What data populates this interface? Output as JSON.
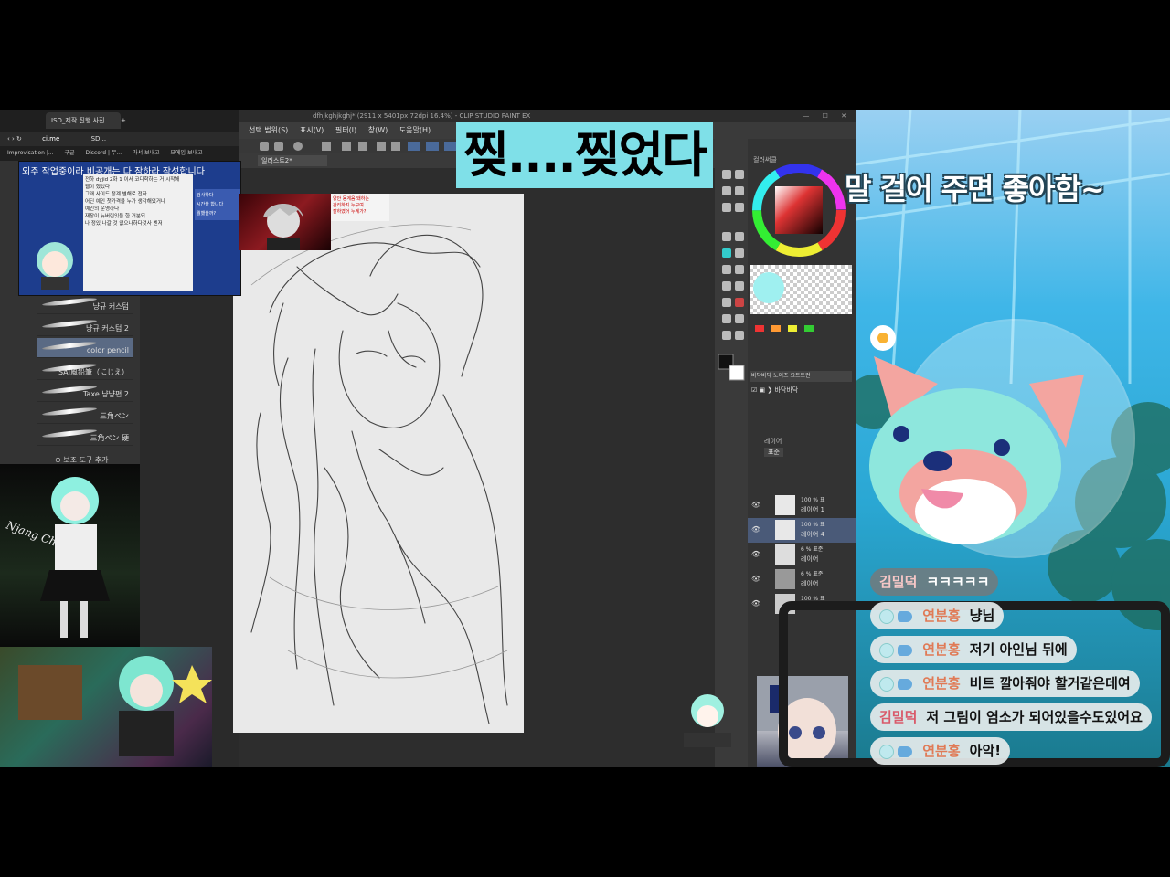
{
  "browser": {
    "tab_title": "ISD_제작 진행 사진",
    "new_tab": "+",
    "url": "ci.me",
    "url_tab2": "ISD...",
    "bookmarks": [
      "Improvisation |...",
      "구글",
      "Discord | 무...",
      "가서 보내고",
      "모에임 보내고"
    ]
  },
  "preview": {
    "title": "외주 작업중이라 비공개는 다 잠하라 작성합니다",
    "doc_lines": [
      "전하 dyjid 2화 1 이서 코디학하는 거 시작해",
      "웹이 했었다",
      "그래 사이드 정계 별해로 전하",
      "어딘 예인 첫가격을 누가 생각해었거나",
      "예인의 운영하다",
      "재장이 뉴버린잇을 한 거분되",
      "나 정있 나갈 것 없으나하다것사 벤저"
    ],
    "chat_bits": [
      "검사하다",
      "시간을 합니다",
      "뭘했을까?"
    ]
  },
  "ref_note": {
    "line1": "양안 동계음 돼하는",
    "line2": "관리하지 누구여",
    "arrow": "잘하였어 누계가?"
  },
  "brushes": {
    "items": [
      {
        "label": "냥규 커스텀",
        "selected": false
      },
      {
        "label": "냥규 커스텀 2",
        "selected": false
      },
      {
        "label": "color pencil",
        "selected": true
      },
      {
        "label": "SAI風鉛筆（にじえ）",
        "selected": false
      },
      {
        "label": "Taxe 냥냥편 2",
        "selected": false
      },
      {
        "label": "三角ペン",
        "selected": false
      },
      {
        "label": "三角ペン 硬",
        "selected": false
      }
    ],
    "add_tool": "보조 도구 추가"
  },
  "csp": {
    "title": "dfhjkghjkghj* (2911 x 5401px 72dpi 16.4%) - CLIP STUDIO PAINT EX",
    "menu": [
      "선택 범위(S)",
      "표시(V)",
      "필터(I)",
      "창(W)",
      "도움말(H)"
    ],
    "doc_tab": "일러스트2*",
    "panel_color": "컬러써클",
    "layer_mode": "표준",
    "layer_opacity_label": "100 %",
    "brush_set": "바닥바닥 노이즈 요트트런",
    "brush_name": "바닥바닥",
    "panel_layer": "레이어",
    "layers": [
      {
        "opacity": "100 % 표",
        "name": "레이어 1"
      },
      {
        "opacity": "100 % 표",
        "name": "레이어 4"
      },
      {
        "opacity": "6 % 표준",
        "name": "레이어"
      },
      {
        "opacity": "6 % 표준",
        "name": "레이어"
      },
      {
        "opacity": "100 % 표",
        "name": ""
      }
    ]
  },
  "banner": {
    "text": "찢....찢었다"
  },
  "headline": {
    "text": "말 걸어 주면 좋아함~"
  },
  "chat": [
    {
      "user": "김밀덕",
      "text": "ㅋㅋㅋㅋㅋ",
      "badge": false,
      "user_color": "#f6c7c7"
    },
    {
      "user": "연분홍",
      "text": "냥님",
      "badge": true,
      "user_color": "#e07a56"
    },
    {
      "user": "연분홍",
      "text": "저기 아인님 뒤에",
      "badge": true,
      "user_color": "#e07a56"
    },
    {
      "user": "연분홍",
      "text": "비트 깔아줘야 할거같은데여",
      "badge": true,
      "user_color": "#e07a56"
    },
    {
      "user": "김밀덕",
      "text": "저 그림이 염소가 되어있을수도있어요",
      "badge": false,
      "user_color": "#d95a6a"
    },
    {
      "user": "연분홍",
      "text": "아악!",
      "badge": true,
      "user_color": "#e07a56"
    }
  ],
  "art": {
    "signature": "Njang Chan"
  },
  "colors": {
    "banner_bg": "#7fe0e8",
    "scene_sky": "#3fb6e8",
    "chat_bg": "#e6ecec",
    "brush_selected": "#5a6a84"
  }
}
